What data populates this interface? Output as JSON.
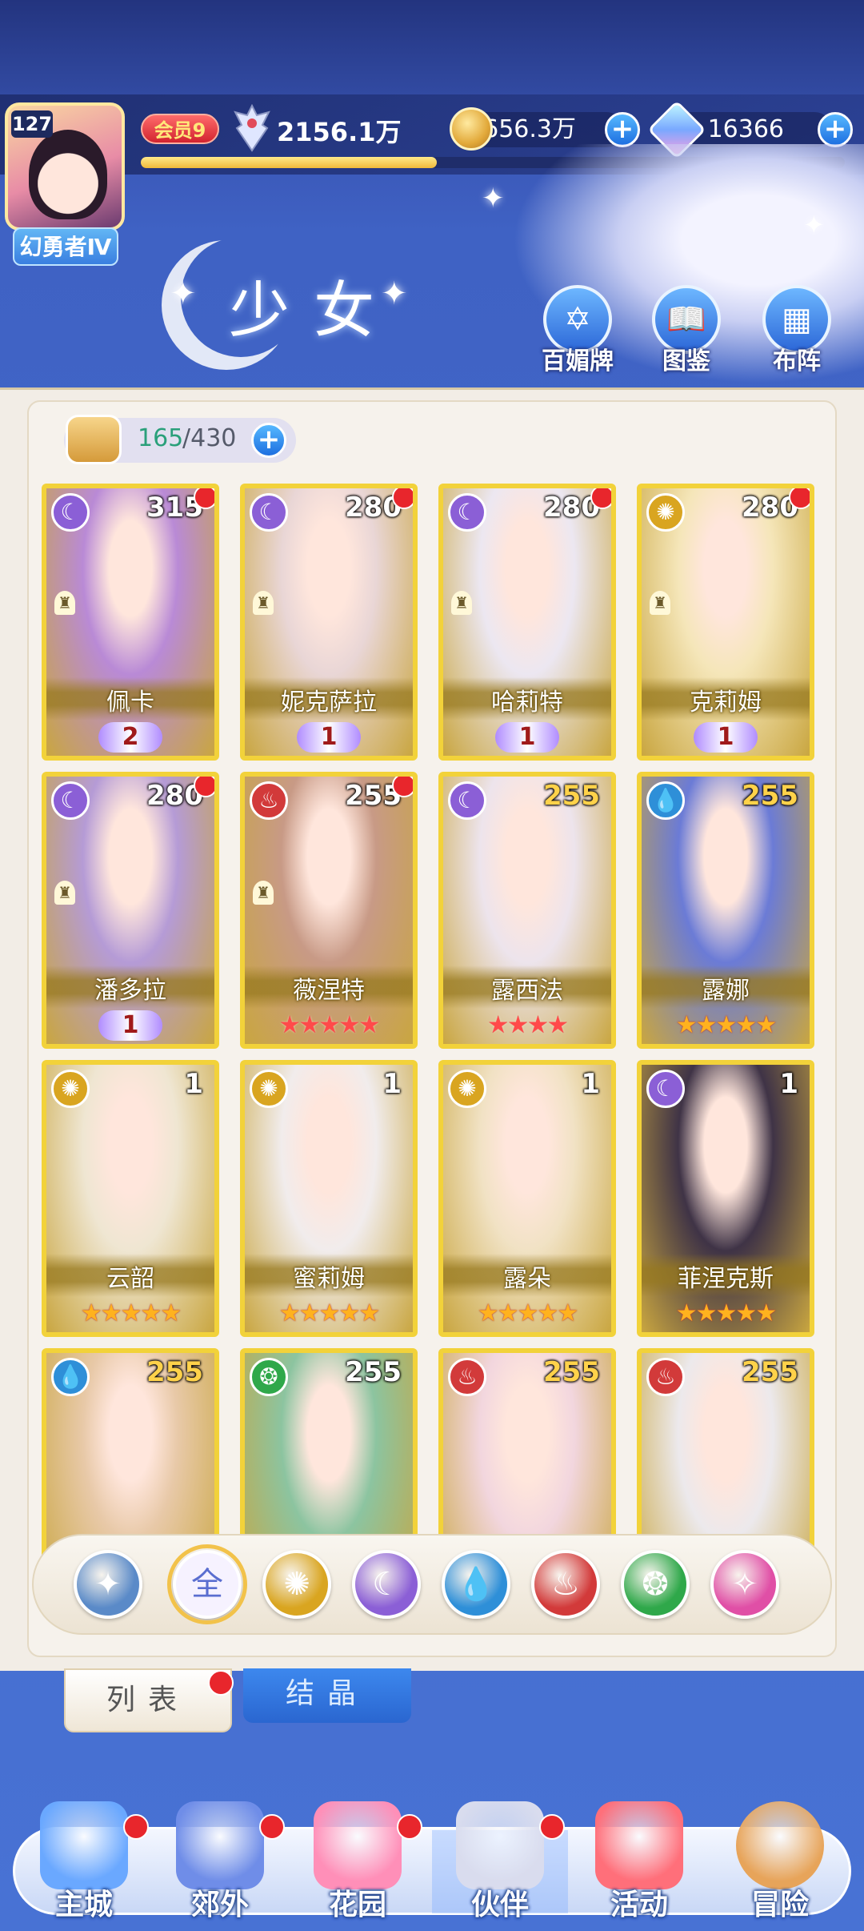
{
  "player": {
    "level": "127",
    "title": "幻勇者Ⅳ",
    "vip": "会员9",
    "power": "2156.1万",
    "exp_fraction": 0.42
  },
  "resources": {
    "gold": "5656.3万",
    "gems": "16366"
  },
  "page": {
    "title": "少女",
    "buttons": [
      {
        "label": "百媚牌",
        "icon": "card-deck-icon"
      },
      {
        "label": "图鉴",
        "icon": "book-icon"
      },
      {
        "label": "布阵",
        "icon": "grid-formation-icon"
      }
    ]
  },
  "inventory": {
    "current": "165",
    "max": "/430"
  },
  "cards": [
    {
      "name": "佩卡",
      "level": "315",
      "element": "moon",
      "red_dot": true,
      "pawn": true,
      "wing": "2",
      "stars": ""
    },
    {
      "name": "妮克萨拉",
      "level": "280",
      "element": "moon",
      "red_dot": true,
      "pawn": true,
      "wing": "1",
      "stars": ""
    },
    {
      "name": "哈莉特",
      "level": "280",
      "element": "moon",
      "red_dot": true,
      "pawn": true,
      "wing": "1",
      "stars": ""
    },
    {
      "name": "克莉姆",
      "level": "280",
      "element": "sun",
      "red_dot": true,
      "pawn": true,
      "wing": "1",
      "stars": ""
    },
    {
      "name": "潘多拉",
      "level": "280",
      "element": "moon",
      "red_dot": true,
      "pawn": true,
      "wing": "1",
      "stars": ""
    },
    {
      "name": "薇涅特",
      "level": "255",
      "element": "fire",
      "red_dot": true,
      "pawn": true,
      "wing": "",
      "stars": "★★★★★",
      "star_style": "red"
    },
    {
      "name": "露西法",
      "level": "255",
      "element": "moon",
      "red_dot": false,
      "pawn": false,
      "wing": "",
      "stars": "★★★★",
      "star_style": "red",
      "gold_level": true
    },
    {
      "name": "露娜",
      "level": "255",
      "element": "water",
      "red_dot": false,
      "pawn": false,
      "wing": "",
      "stars": "★★★★★",
      "gold_level": true
    },
    {
      "name": "云韶",
      "level": "1",
      "element": "sun",
      "red_dot": false,
      "pawn": false,
      "wing": "",
      "stars": "★★★★★"
    },
    {
      "name": "蜜莉姆",
      "level": "1",
      "element": "sun",
      "red_dot": false,
      "pawn": false,
      "wing": "",
      "stars": "★★★★★"
    },
    {
      "name": "露朵",
      "level": "1",
      "element": "sun",
      "red_dot": false,
      "pawn": false,
      "wing": "",
      "stars": "★★★★★"
    },
    {
      "name": "菲涅克斯",
      "level": "1",
      "element": "moon",
      "red_dot": false,
      "pawn": false,
      "wing": "",
      "stars": "★★★★★"
    },
    {
      "name": "",
      "level": "255",
      "element": "water",
      "red_dot": false,
      "pawn": false,
      "wing": "",
      "stars": "",
      "gold_level": true
    },
    {
      "name": "",
      "level": "255",
      "element": "wind",
      "red_dot": false,
      "pawn": false,
      "wing": "",
      "stars": ""
    },
    {
      "name": "",
      "level": "255",
      "element": "fire",
      "red_dot": false,
      "pawn": false,
      "wing": "",
      "stars": "",
      "gold_level": true
    },
    {
      "name": "",
      "level": "255",
      "element": "fire",
      "red_dot": false,
      "pawn": false,
      "wing": "",
      "stars": "",
      "gold_level": true
    }
  ],
  "element_colors": {
    "moon": "#8b5fd6",
    "sun": "#d9a520",
    "fire": "#d23a3a",
    "water": "#2e8fd8",
    "wind": "#2fa84a",
    "star": "#e04fa6",
    "light": "#4d7fc4"
  },
  "filters": [
    {
      "key": "light",
      "label": "",
      "icon": "light-element-icon",
      "color": "#5a8ac8"
    },
    {
      "key": "all",
      "label": "全",
      "icon": "all-elements-icon",
      "color": "#5a6ed0",
      "selected": true
    },
    {
      "key": "sun",
      "label": "",
      "icon": "sun-element-icon",
      "color": "#d9a520"
    },
    {
      "key": "moon",
      "label": "",
      "icon": "moon-element-icon",
      "color": "#8b5fd6"
    },
    {
      "key": "water",
      "label": "",
      "icon": "water-element-icon",
      "color": "#2e8fd8"
    },
    {
      "key": "fire",
      "label": "",
      "icon": "fire-element-icon",
      "color": "#d23a3a"
    },
    {
      "key": "wind",
      "label": "",
      "icon": "wind-element-icon",
      "color": "#2fa84a"
    },
    {
      "key": "star",
      "label": "",
      "icon": "star-element-icon",
      "color": "#e04fa6"
    }
  ],
  "subtabs": {
    "list": "列表",
    "crystal": "结晶"
  },
  "nav": [
    {
      "label": "主城",
      "icon": "castle-icon",
      "red_dot": true
    },
    {
      "label": "郊外",
      "icon": "portal-icon",
      "red_dot": true
    },
    {
      "label": "花园",
      "icon": "heart-icon",
      "red_dot": true
    },
    {
      "label": "伙伴",
      "icon": "partner-portrait-icon",
      "red_dot": true,
      "active": true
    },
    {
      "label": "活动",
      "icon": "gift-box-icon",
      "red_dot": false
    },
    {
      "label": "冒险",
      "icon": "compass-icon",
      "red_dot": false
    }
  ]
}
